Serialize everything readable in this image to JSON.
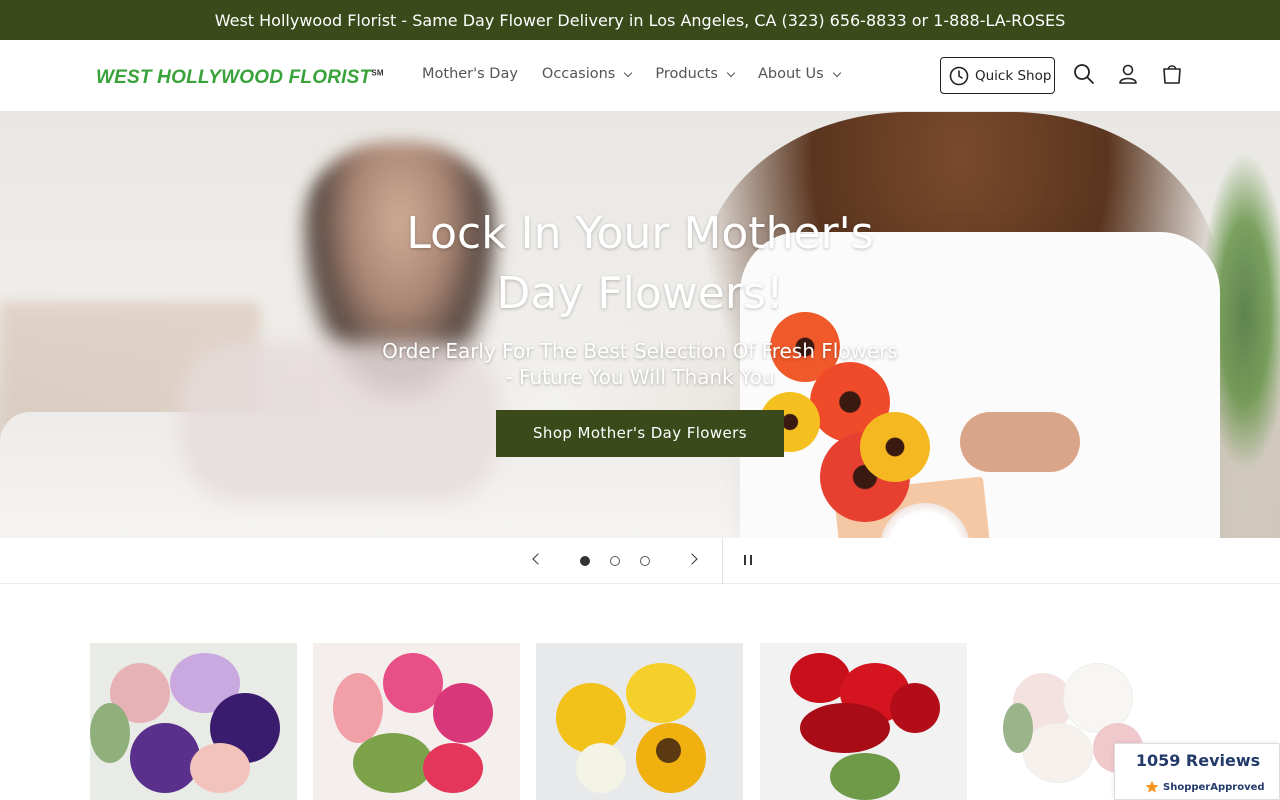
{
  "announcement": "West Hollywood Florist - Same Day Flower Delivery in Los Angeles, CA (323) 656-8833 or 1-888-LA-ROSES",
  "header": {
    "logo": "WEST HOLLYWOOD FLORIST",
    "logo_mark": "SM",
    "nav": [
      {
        "label": "Mother's Day",
        "dropdown": false
      },
      {
        "label": "Occasions",
        "dropdown": true
      },
      {
        "label": "Products",
        "dropdown": true
      },
      {
        "label": "About Us",
        "dropdown": true
      }
    ],
    "quick_shop": "Quick Shop",
    "icons": [
      "search-icon",
      "account-icon",
      "cart-icon"
    ]
  },
  "hero": {
    "title_line1": "Lock In Your Mother's",
    "title_line2": "Day Flowers!",
    "subtitle_line1": "Order Early For The Best Selection Of Fresh Flowers",
    "subtitle_line2": "- Future You Will Thank You",
    "cta": "Shop Mother's Day Flowers"
  },
  "slider": {
    "slide_count": 3,
    "active_index": 0
  },
  "reviews": {
    "count_label": "1059 Reviews",
    "brand": "ShopperApproved"
  },
  "colors": {
    "brand_dark": "#3a4a1a",
    "logo_green": "#3aa23a",
    "badge_blue": "#233a6b"
  }
}
